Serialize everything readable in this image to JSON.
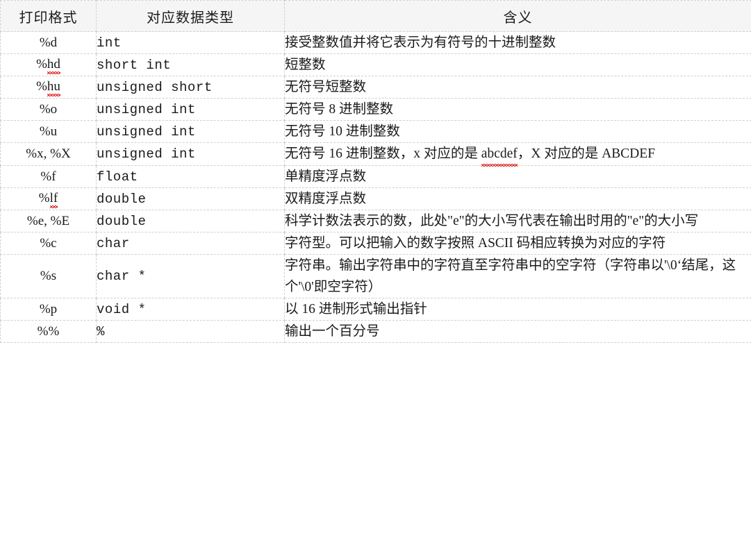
{
  "table": {
    "headers": {
      "format": "打印格式",
      "datatype": "对应数据类型",
      "meaning": "含义"
    },
    "rows": [
      {
        "format": "%d",
        "format_plain": "%d",
        "format_squiggle": "",
        "datatype": "int",
        "meaning": "接受整数值并将它表示为有符号的十进制整数"
      },
      {
        "format": "%hd",
        "format_plain": "%",
        "format_squiggle": "hd",
        "datatype": "short int",
        "meaning": "短整数"
      },
      {
        "format": "%hu",
        "format_plain": "%",
        "format_squiggle": "hu",
        "datatype": "unsigned short",
        "meaning": "无符号短整数"
      },
      {
        "format": "%o",
        "format_plain": "%o",
        "format_squiggle": "",
        "datatype": "unsigned int",
        "meaning": "无符号 8 进制整数"
      },
      {
        "format": "%u",
        "format_plain": "%u",
        "format_squiggle": "",
        "datatype": "unsigned int",
        "meaning": "无符号 10 进制整数"
      },
      {
        "format": "%x,%X",
        "format_plain": "%x, %X",
        "format_squiggle": "",
        "datatype": "unsigned int",
        "meaning_pre": "无符号 16 进制整数，x 对应的是 ",
        "meaning_squiggle": "abcdef",
        "meaning_post": "，X 对应的是 ABCDEF",
        "meaning": "无符号 16 进制整数，x 对应的是 abcdef，X 对应的是 ABCDEF"
      },
      {
        "format": "%f",
        "format_plain": "%f",
        "format_squiggle": "",
        "datatype": "float",
        "meaning": "单精度浮点数"
      },
      {
        "format": "%lf",
        "format_plain": "%",
        "format_squiggle": "lf",
        "datatype": "double",
        "meaning": "双精度浮点数"
      },
      {
        "format": "%e,%E",
        "format_plain": "%e, %E",
        "format_squiggle": "",
        "datatype": "double",
        "meaning": "科学计数法表示的数，此处\"e\"的大小写代表在输出时用的\"e\"的大小写"
      },
      {
        "format": "%c",
        "format_plain": "%c",
        "format_squiggle": "",
        "datatype": "char",
        "meaning": "字符型。可以把输入的数字按照 ASCII 码相应转换为对应的字符"
      },
      {
        "format": "%s",
        "format_plain": "%s",
        "format_squiggle": "",
        "datatype": "char *",
        "meaning": "字符串。输出字符串中的字符直至字符串中的空字符（字符串以'\\0‘结尾，这个'\\0'即空字符）"
      },
      {
        "format": "%p",
        "format_plain": "%p",
        "format_squiggle": "",
        "datatype": "void *",
        "meaning": "以 16 进制形式输出指针"
      },
      {
        "format": "%%",
        "format_plain": "%%",
        "format_squiggle": "",
        "datatype": "%",
        "meaning": "输出一个百分号"
      }
    ]
  },
  "colors": {
    "header_background": "#f5f5f5",
    "border": "#cfcfcf",
    "text": "#1a1a1a",
    "spellcheck_underline": "#e02020"
  }
}
